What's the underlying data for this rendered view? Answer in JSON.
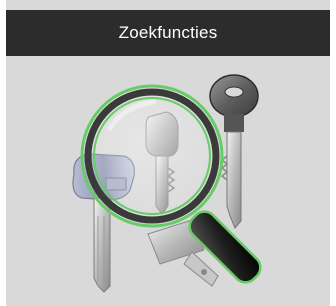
{
  "header": {
    "title": "Zoekfuncties"
  },
  "illustration": {
    "icon": "magnifier-over-keys",
    "accent_color": "#66cc66",
    "background_color": "#d9d9d9",
    "header_color": "#2c2c2c"
  }
}
